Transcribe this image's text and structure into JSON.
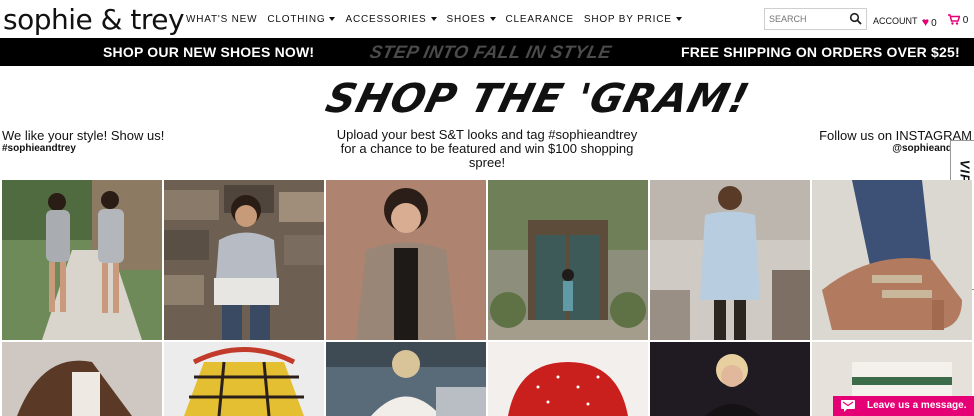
{
  "header": {
    "logo": "sophie & trey",
    "nav": [
      {
        "label": "WHAT'S NEW",
        "dropdown": false
      },
      {
        "label": "CLOTHING",
        "dropdown": true
      },
      {
        "label": "ACCESSORIES",
        "dropdown": true
      },
      {
        "label": "SHOES",
        "dropdown": true
      },
      {
        "label": "CLEARANCE",
        "dropdown": false
      },
      {
        "label": "SHOP BY PRICE",
        "dropdown": true
      }
    ],
    "search_placeholder": "SEARCH",
    "account_label": "ACCOUNT",
    "wishlist_count": "0",
    "cart_count": "0"
  },
  "promo": {
    "left": "SHOP OUR NEW SHOES NOW!",
    "center": "STEP INTO FALL IN STYLE",
    "right": "FREE SHIPPING ON ORDERS OVER $25!"
  },
  "gram": {
    "title": "SHOP THE 'GRAM!",
    "left_text": "We like your style! Show us!",
    "left_tag": "#sophieandtrey",
    "center_text": "Upload your best S&T looks and tag #sophieandtrey for a chance to be featured and win $100 shopping spree!",
    "right_text": "Follow us on INSTAGRAM",
    "right_tag": "@sophieand"
  },
  "vip_tab": "VIP REWARDS",
  "chat": {
    "label": "Leave us a message."
  },
  "colors": {
    "accent": "#e60076",
    "promo_bg": "#000000",
    "promo_center": "#4b4b4b"
  },
  "photos": [
    {
      "subject": "two-women-gray-dresses"
    },
    {
      "subject": "woman-gray-hoodie"
    },
    {
      "subject": "woman-fuzzy-cardigan"
    },
    {
      "subject": "ivy-covered-door"
    },
    {
      "subject": "woman-shirt-dress"
    },
    {
      "subject": "suede-buckle-booties"
    },
    {
      "subject": "brown-moto-jacket"
    },
    {
      "subject": "plaid-shirt-flatlay"
    },
    {
      "subject": "blonde-woman-sweater"
    },
    {
      "subject": "red-polka-dot-dress"
    },
    {
      "subject": "woman-black-sweater"
    },
    {
      "subject": "striped-sweater"
    }
  ]
}
